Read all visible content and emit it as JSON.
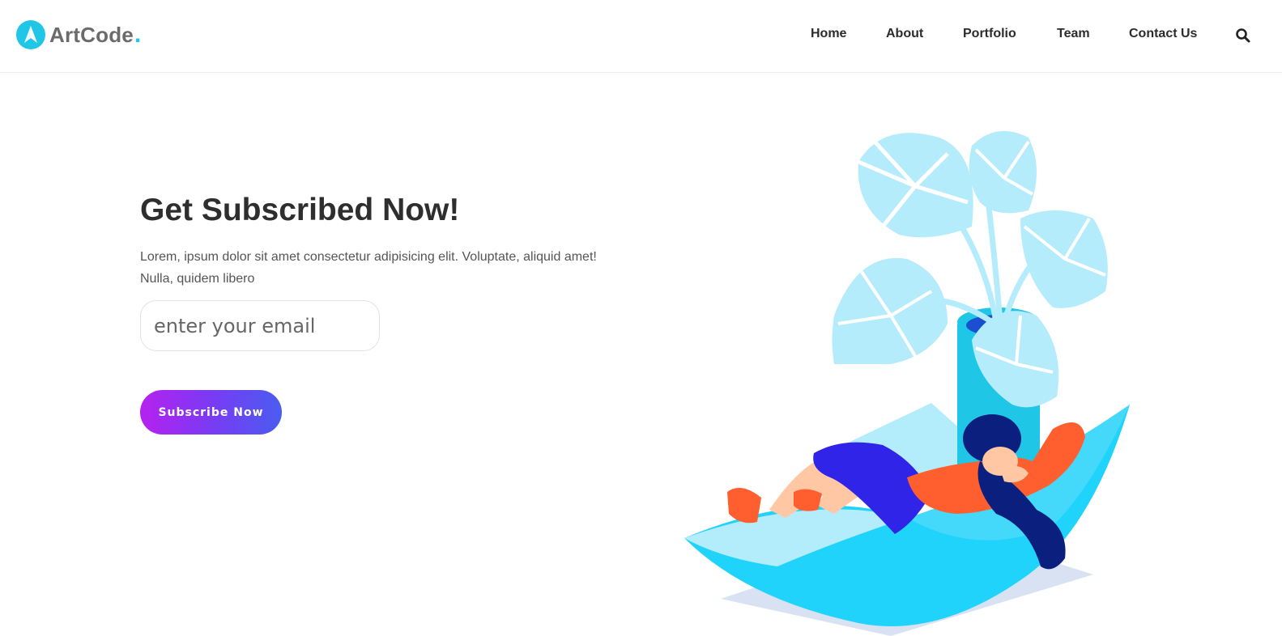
{
  "brand": {
    "name": "ArtCode",
    "dot": ".",
    "accent_color": "#1fc6e6"
  },
  "nav": {
    "items": [
      {
        "label": "Home"
      },
      {
        "label": "About"
      },
      {
        "label": "Portfolio"
      },
      {
        "label": "Team"
      },
      {
        "label": "Contact Us"
      }
    ],
    "search_icon": "search-icon"
  },
  "hero": {
    "title": "Get Subscribed Now!",
    "text": "Lorem, ipsum dolor sit amet consectetur adipisicing elit. Voluptate, aliquid amet! Nulla, quidem libero",
    "email_placeholder": "enter your email",
    "subscribe_label": "Subscribe Now",
    "button_gradient": [
      "#b621ef",
      "#4a5cf0"
    ]
  },
  "illustration": {
    "subject": "person-relaxing-with-plant-illustration",
    "colors": {
      "plant": "#b5ecfb",
      "pot": "#1fc6e6",
      "couch": "#1fd3fb",
      "shirt": "#ff5f2e",
      "pants": "#3024e8",
      "hair": "#0b1f7e"
    }
  }
}
